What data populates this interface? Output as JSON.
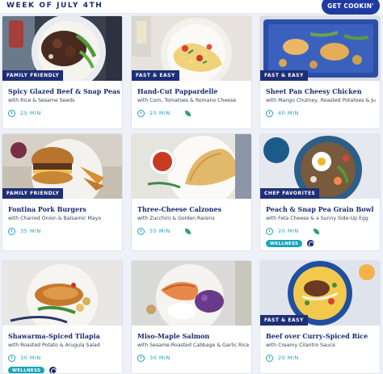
{
  "header": {
    "week_label": "WEEK OF JULY 4TH",
    "cta_label": "GET COOKIN'"
  },
  "recipes": [
    {
      "badge": "FAMILY FRIENDLY",
      "title": "Spicy Glazed Beef & Snap Peas",
      "subtitle": "with Rice & Sesame Seeds",
      "time": "25 MIN",
      "leaf": false,
      "wellness": false
    },
    {
      "badge": "FAST & EASY",
      "title": "Hand-Cut Pappardelle",
      "subtitle": "with Corn, Tomatoes & Romano Cheese",
      "time": "20 MIN",
      "leaf": true,
      "wellness": false
    },
    {
      "badge": "FAST & EASY",
      "title": "Sheet Pan Cheesy Chicken",
      "subtitle": "with Mango Chutney, Roasted Potatoes & Ju",
      "time": "40 MIN",
      "leaf": false,
      "wellness": false
    },
    {
      "badge": "FAMILY FRIENDLY",
      "title": "Fontina Pork Burgers",
      "subtitle": "with Charred Onion & Balsamic Mayo",
      "time": "35 MIN",
      "leaf": false,
      "wellness": false
    },
    {
      "badge": "",
      "title": "Three-Cheese Calzones",
      "subtitle": "with Zucchini & Golden Raisins",
      "time": "55 MIN",
      "leaf": true,
      "wellness": false
    },
    {
      "badge": "CHEF FAVORITES",
      "title": "Peach & Snap Pea Grain Bowl",
      "subtitle": "with Feta Cheese & a Sunny Side-Up Egg",
      "time": "20 MIN",
      "leaf": true,
      "wellness": true,
      "wellness_label": "WELLNESS"
    },
    {
      "badge": "",
      "title": "Shawarma-Spiced Tilapia",
      "subtitle": "with Roasted Potato & Arugula Salad",
      "time": "30 MIN",
      "leaf": false,
      "wellness": true,
      "wellness_label": "WELLNESS"
    },
    {
      "badge": "",
      "title": "Miso-Maple Salmon",
      "subtitle": "with Sesame-Roasted Cabbage & Garlic Rice",
      "time": "30 MIN",
      "leaf": false,
      "wellness": false
    },
    {
      "badge": "FAST & EASY",
      "title": "Beef over Curry-Spiced Rice",
      "subtitle": "with Creamy Cilantro Sauce",
      "time": "20 MIN",
      "leaf": false,
      "wellness": false
    }
  ]
}
